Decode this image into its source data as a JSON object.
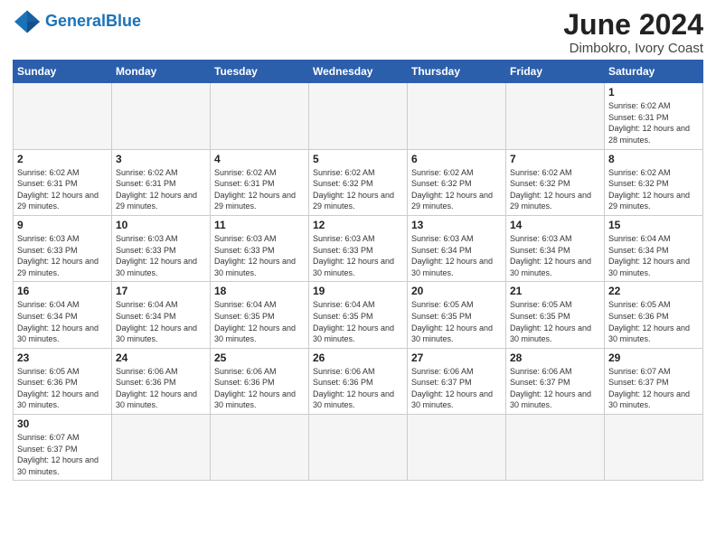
{
  "logo": {
    "text_general": "General",
    "text_blue": "Blue"
  },
  "header": {
    "title": "June 2024",
    "subtitle": "Dimbokro, Ivory Coast"
  },
  "weekdays": [
    "Sunday",
    "Monday",
    "Tuesday",
    "Wednesday",
    "Thursday",
    "Friday",
    "Saturday"
  ],
  "weeks": [
    [
      {
        "day": "",
        "info": ""
      },
      {
        "day": "",
        "info": ""
      },
      {
        "day": "",
        "info": ""
      },
      {
        "day": "",
        "info": ""
      },
      {
        "day": "",
        "info": ""
      },
      {
        "day": "",
        "info": ""
      },
      {
        "day": "1",
        "info": "Sunrise: 6:02 AM\nSunset: 6:31 PM\nDaylight: 12 hours\nand 28 minutes."
      }
    ],
    [
      {
        "day": "2",
        "info": "Sunrise: 6:02 AM\nSunset: 6:31 PM\nDaylight: 12 hours\nand 29 minutes."
      },
      {
        "day": "3",
        "info": "Sunrise: 6:02 AM\nSunset: 6:31 PM\nDaylight: 12 hours\nand 29 minutes."
      },
      {
        "day": "4",
        "info": "Sunrise: 6:02 AM\nSunset: 6:31 PM\nDaylight: 12 hours\nand 29 minutes."
      },
      {
        "day": "5",
        "info": "Sunrise: 6:02 AM\nSunset: 6:32 PM\nDaylight: 12 hours\nand 29 minutes."
      },
      {
        "day": "6",
        "info": "Sunrise: 6:02 AM\nSunset: 6:32 PM\nDaylight: 12 hours\nand 29 minutes."
      },
      {
        "day": "7",
        "info": "Sunrise: 6:02 AM\nSunset: 6:32 PM\nDaylight: 12 hours\nand 29 minutes."
      },
      {
        "day": "8",
        "info": "Sunrise: 6:02 AM\nSunset: 6:32 PM\nDaylight: 12 hours\nand 29 minutes."
      }
    ],
    [
      {
        "day": "9",
        "info": "Sunrise: 6:03 AM\nSunset: 6:33 PM\nDaylight: 12 hours\nand 29 minutes."
      },
      {
        "day": "10",
        "info": "Sunrise: 6:03 AM\nSunset: 6:33 PM\nDaylight: 12 hours\nand 30 minutes."
      },
      {
        "day": "11",
        "info": "Sunrise: 6:03 AM\nSunset: 6:33 PM\nDaylight: 12 hours\nand 30 minutes."
      },
      {
        "day": "12",
        "info": "Sunrise: 6:03 AM\nSunset: 6:33 PM\nDaylight: 12 hours\nand 30 minutes."
      },
      {
        "day": "13",
        "info": "Sunrise: 6:03 AM\nSunset: 6:34 PM\nDaylight: 12 hours\nand 30 minutes."
      },
      {
        "day": "14",
        "info": "Sunrise: 6:03 AM\nSunset: 6:34 PM\nDaylight: 12 hours\nand 30 minutes."
      },
      {
        "day": "15",
        "info": "Sunrise: 6:04 AM\nSunset: 6:34 PM\nDaylight: 12 hours\nand 30 minutes."
      }
    ],
    [
      {
        "day": "16",
        "info": "Sunrise: 6:04 AM\nSunset: 6:34 PM\nDaylight: 12 hours\nand 30 minutes."
      },
      {
        "day": "17",
        "info": "Sunrise: 6:04 AM\nSunset: 6:34 PM\nDaylight: 12 hours\nand 30 minutes."
      },
      {
        "day": "18",
        "info": "Sunrise: 6:04 AM\nSunset: 6:35 PM\nDaylight: 12 hours\nand 30 minutes."
      },
      {
        "day": "19",
        "info": "Sunrise: 6:04 AM\nSunset: 6:35 PM\nDaylight: 12 hours\nand 30 minutes."
      },
      {
        "day": "20",
        "info": "Sunrise: 6:05 AM\nSunset: 6:35 PM\nDaylight: 12 hours\nand 30 minutes."
      },
      {
        "day": "21",
        "info": "Sunrise: 6:05 AM\nSunset: 6:35 PM\nDaylight: 12 hours\nand 30 minutes."
      },
      {
        "day": "22",
        "info": "Sunrise: 6:05 AM\nSunset: 6:36 PM\nDaylight: 12 hours\nand 30 minutes."
      }
    ],
    [
      {
        "day": "23",
        "info": "Sunrise: 6:05 AM\nSunset: 6:36 PM\nDaylight: 12 hours\nand 30 minutes."
      },
      {
        "day": "24",
        "info": "Sunrise: 6:06 AM\nSunset: 6:36 PM\nDaylight: 12 hours\nand 30 minutes."
      },
      {
        "day": "25",
        "info": "Sunrise: 6:06 AM\nSunset: 6:36 PM\nDaylight: 12 hours\nand 30 minutes."
      },
      {
        "day": "26",
        "info": "Sunrise: 6:06 AM\nSunset: 6:36 PM\nDaylight: 12 hours\nand 30 minutes."
      },
      {
        "day": "27",
        "info": "Sunrise: 6:06 AM\nSunset: 6:37 PM\nDaylight: 12 hours\nand 30 minutes."
      },
      {
        "day": "28",
        "info": "Sunrise: 6:06 AM\nSunset: 6:37 PM\nDaylight: 12 hours\nand 30 minutes."
      },
      {
        "day": "29",
        "info": "Sunrise: 6:07 AM\nSunset: 6:37 PM\nDaylight: 12 hours\nand 30 minutes."
      }
    ],
    [
      {
        "day": "30",
        "info": "Sunrise: 6:07 AM\nSunset: 6:37 PM\nDaylight: 12 hours\nand 30 minutes."
      },
      {
        "day": "",
        "info": ""
      },
      {
        "day": "",
        "info": ""
      },
      {
        "day": "",
        "info": ""
      },
      {
        "day": "",
        "info": ""
      },
      {
        "day": "",
        "info": ""
      },
      {
        "day": "",
        "info": ""
      }
    ]
  ]
}
